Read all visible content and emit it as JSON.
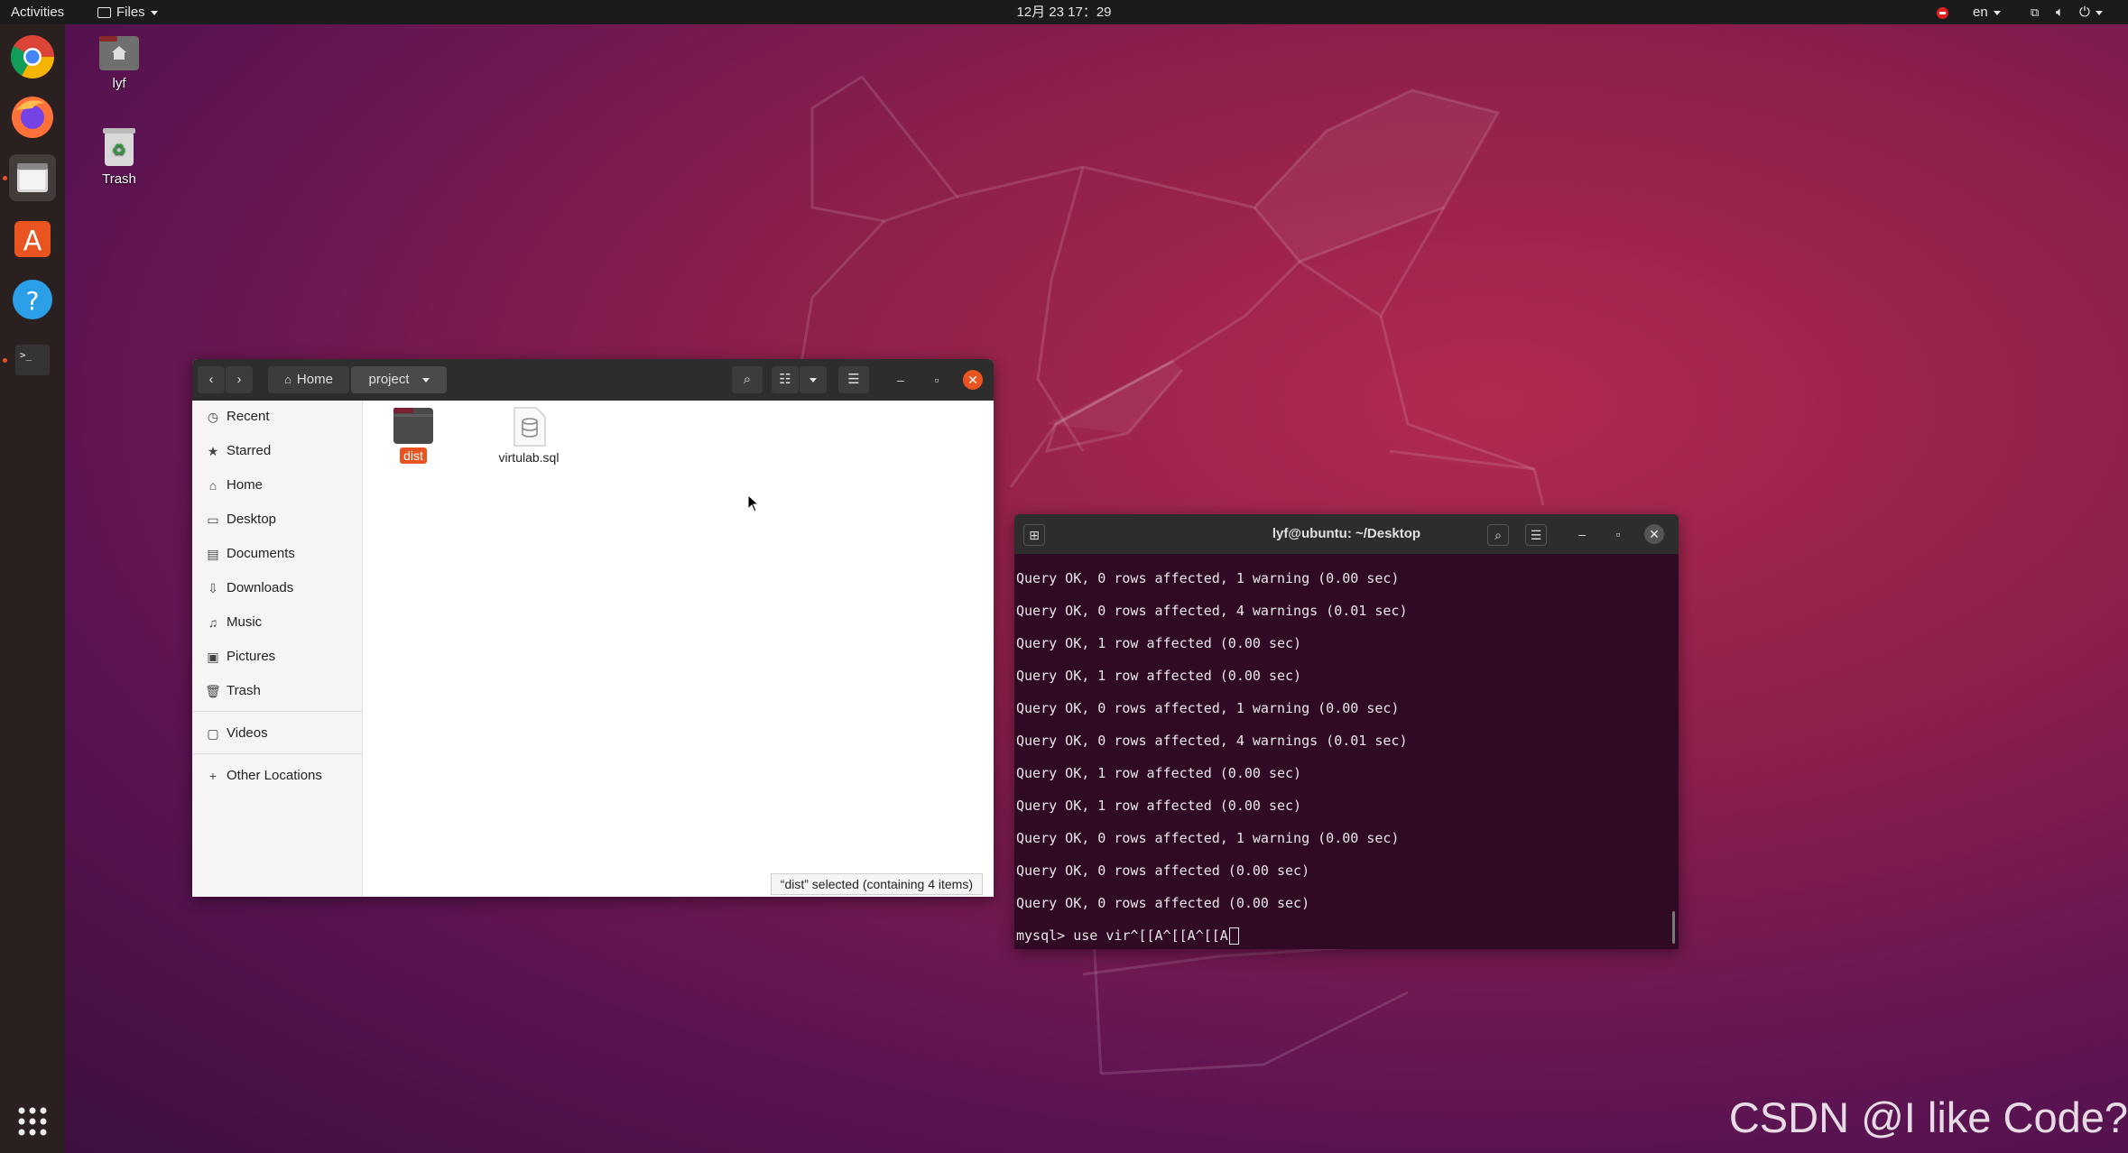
{
  "topbar": {
    "activities": "Activities",
    "app_menu": "Files",
    "clock": "12月 23  17：29",
    "language": "en"
  },
  "desktop": {
    "home_label": "lyf",
    "trash_label": "Trash"
  },
  "file_manager": {
    "path": [
      "Home",
      "project"
    ],
    "sidebar": [
      {
        "label": "Recent",
        "icon": "clock-icon"
      },
      {
        "label": "Starred",
        "icon": "star-icon"
      },
      {
        "label": "Home",
        "icon": "home-icon"
      },
      {
        "label": "Desktop",
        "icon": "desktop-icon"
      },
      {
        "label": "Documents",
        "icon": "documents-icon"
      },
      {
        "label": "Downloads",
        "icon": "download-icon"
      },
      {
        "label": "Music",
        "icon": "music-icon"
      },
      {
        "label": "Pictures",
        "icon": "pictures-icon"
      },
      {
        "label": "Trash",
        "icon": "trash-icon"
      },
      {
        "label": "Videos",
        "icon": "videos-icon"
      },
      {
        "label": "Other Locations",
        "icon": "plus-icon"
      }
    ],
    "files": [
      {
        "name": "dist",
        "type": "folder"
      },
      {
        "name": "virtulab.sql",
        "type": "database"
      }
    ],
    "status": "“dist” selected  (containing 4 items)"
  },
  "terminal": {
    "title": "lyf@ubuntu: ~/Desktop",
    "lines": [
      "Query OK, 0 rows affected, 1 warning (0.00 sec)",
      "Query OK, 0 rows affected, 4 warnings (0.01 sec)",
      "Query OK, 1 row affected (0.00 sec)",
      "Query OK, 1 row affected (0.00 sec)",
      "Query OK, 0 rows affected, 1 warning (0.00 sec)",
      "Query OK, 0 rows affected, 4 warnings (0.01 sec)",
      "Query OK, 1 row affected (0.00 sec)",
      "Query OK, 1 row affected (0.00 sec)",
      "Query OK, 0 rows affected, 1 warning (0.00 sec)",
      "Query OK, 0 rows affected (0.00 sec)",
      "Query OK, 0 rows affected (0.00 sec)"
    ],
    "prompt": "mysql> use vir^[[A^[[A^[[A"
  },
  "watermark": "CSDN @I like Code?",
  "colors": {
    "accent": "#e95420",
    "terminal_bg": "#300a24",
    "header": "#2d2d2d"
  }
}
